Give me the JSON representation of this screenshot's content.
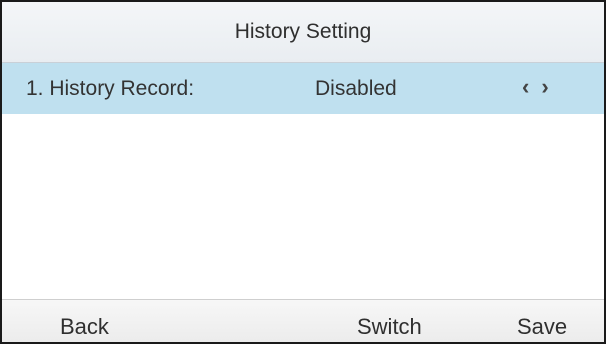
{
  "header": {
    "title": "History Setting"
  },
  "settings": {
    "items": [
      {
        "label": "1. History Record:",
        "value": "Disabled",
        "left_arrow": "‹",
        "right_arrow": "›"
      }
    ]
  },
  "softkeys": {
    "back": "Back",
    "switch": "Switch",
    "save": "Save"
  }
}
